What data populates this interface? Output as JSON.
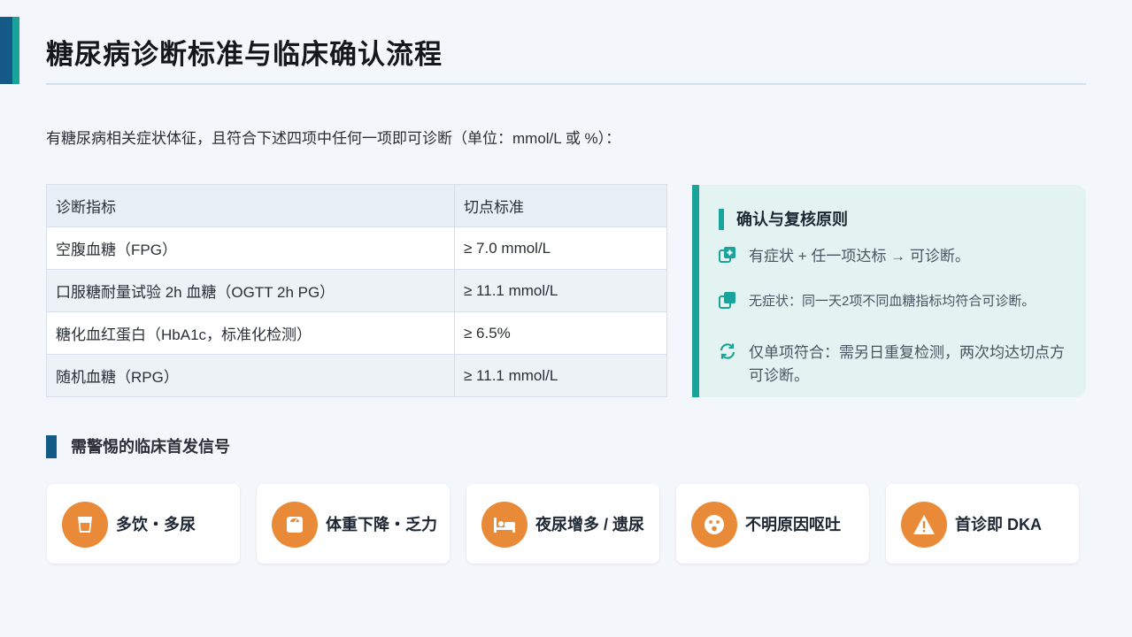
{
  "title": "糖尿病诊断标准与临床确认流程",
  "intro": "有糖尿病相关症状体征，且符合下述四项中任何一项即可诊断（单位：mmol/L 或 %）：",
  "table": {
    "headers": [
      "诊断指标",
      "切点标准"
    ],
    "rows": [
      [
        "空腹血糖（FPG）",
        "≥ 7.0 mmol/L"
      ],
      [
        "口服糖耐量试验 2h 血糖（OGTT 2h PG）",
        "≥ 11.1 mmol/L"
      ],
      [
        "糖化血红蛋白（HbA1c，标准化检测）",
        "≥ 6.5%"
      ],
      [
        "随机血糖（RPG）",
        "≥ 11.1 mmol/L"
      ]
    ]
  },
  "principles": {
    "heading": "确认与复核原则",
    "items": [
      {
        "icon": "add-copy-icon",
        "text": "有症状 + 任一项达标 → 可诊断。"
      },
      {
        "icon": "copy-icon",
        "text": "无症状：同一天2项不同血糖指标均符合可诊断。"
      },
      {
        "icon": "repeat-icon",
        "text": "仅单项符合：需另日重复检测，两次均达切点方可诊断。"
      }
    ]
  },
  "signals": {
    "heading": "需警惕的临床首发信号",
    "cards": [
      {
        "icon": "cup-icon",
        "label": "多饮・多尿"
      },
      {
        "icon": "scale-icon",
        "label": "体重下降・乏力"
      },
      {
        "icon": "bed-icon",
        "label": "夜尿增多 / 遗尿"
      },
      {
        "icon": "sick-face-icon",
        "label": "不明原因呕吐"
      },
      {
        "icon": "warning-icon",
        "label": "首诊即 DKA"
      }
    ]
  },
  "colors": {
    "navy": "#145a86",
    "teal": "#1aa39a",
    "orange": "#e88a38",
    "panel": "#e3f3f1"
  }
}
